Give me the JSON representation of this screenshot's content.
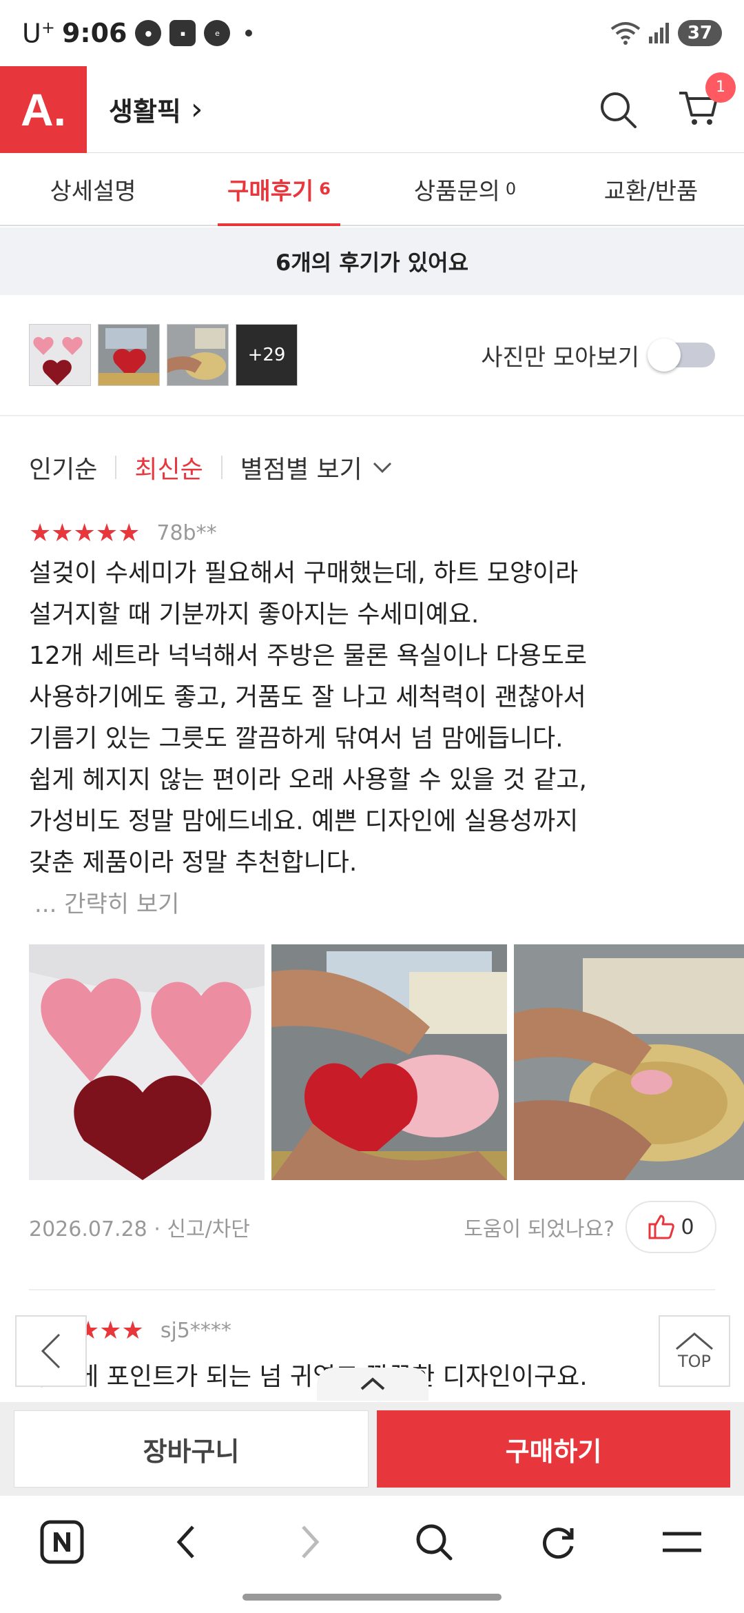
{
  "status_bar": {
    "carrier": "U",
    "carrier_sup": "+",
    "time": "9:06",
    "battery": "37",
    "wifi_num": "6"
  },
  "header": {
    "logo": "A.",
    "title": "생활픽",
    "title_chevron": "›",
    "cart_count": "1"
  },
  "tabs": [
    {
      "label": "상세설명",
      "count": ""
    },
    {
      "label": "구매후기",
      "count": "6"
    },
    {
      "label": "상품문의",
      "count": "0"
    },
    {
      "label": "교환/반품",
      "count": ""
    }
  ],
  "review_count_banner": "6개의 후기가 있어요",
  "photo_strip": {
    "more_count": "+29",
    "photo_only_label": "사진만 모아보기"
  },
  "sort": {
    "options": [
      "인기순",
      "최신순"
    ],
    "filter_label": "별점별 보기"
  },
  "review1": {
    "stars": "★★★★★",
    "user": "78b**",
    "text": "설겆이 수세미가 필요해서 구매했는데, 하트 모양이라\n설거지할 때 기분까지 좋아지는 수세미예요.\n12개 세트라 넉넉해서 주방은 물론 욕실이나 다용도로\n사용하기에도 좋고, 거품도 잘 나고 세척력이 괜찮아서\n기름기 있는 그릇도 깔끔하게 닦여서 넘 맘에듭니다.\n쉽게 헤지지 않는 편이라 오래 사용할 수 있을 것 같고,\n가성비도 정말 맘에드네요. 예쁜 디자인에 실용성까지\n갖춘 제품이라 정말 추천합니다.",
    "collapse_label": "... 간략히 보기",
    "date": "2026.07.28",
    "report_label": "신고/차단",
    "helpful_label": "도움이 되었나요?",
    "like_count": "0"
  },
  "review2": {
    "user": "sj5****",
    "text_partial": "주방에 포인트가 되는 넘 귀엽고 깔끔한 디자인이구요."
  },
  "float_top_label": "TOP",
  "buy_bar": {
    "cart_label": "장바구니",
    "buy_label": "구매하기"
  },
  "colors": {
    "accent": "#e8363d"
  }
}
